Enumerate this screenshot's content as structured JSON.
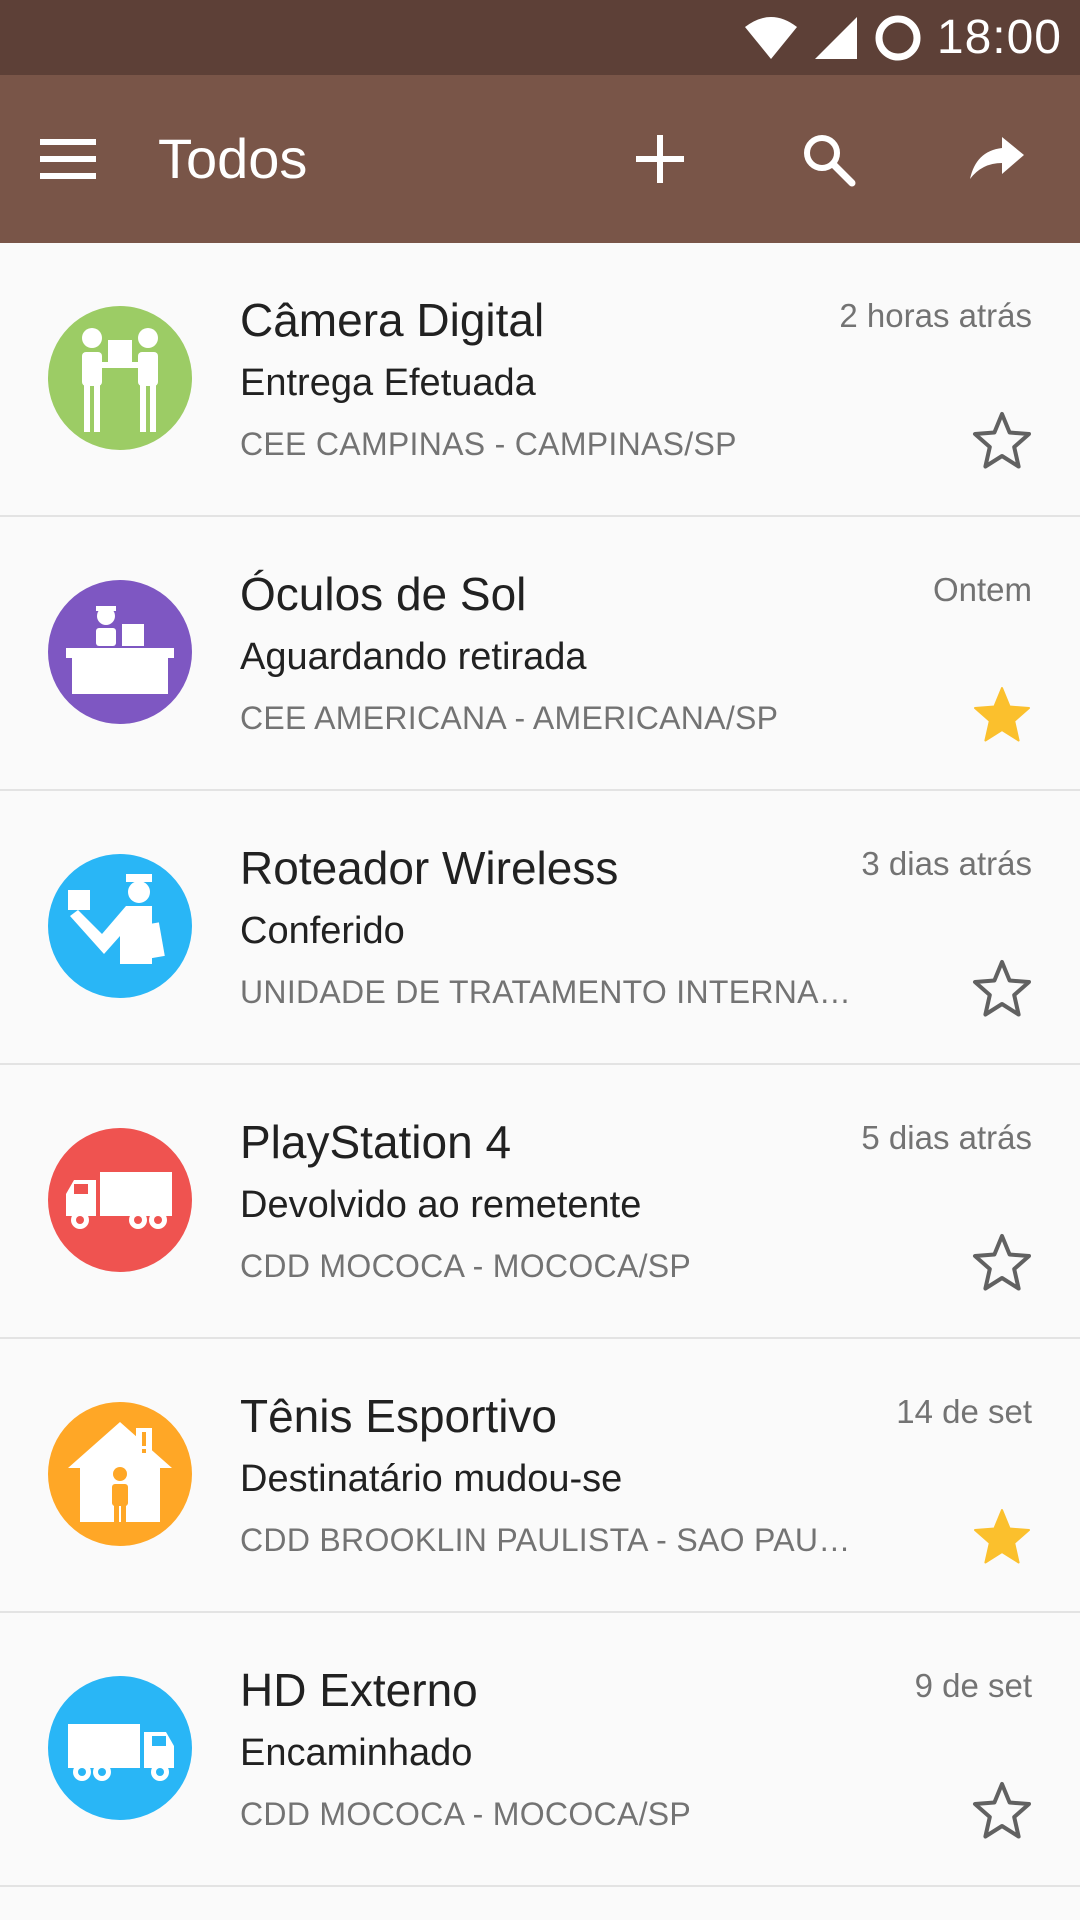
{
  "status_bar": {
    "time": "18:00",
    "icons": [
      "wifi-icon",
      "signal-icon",
      "sync-icon"
    ]
  },
  "app_bar": {
    "title": "Todos",
    "icons": [
      "menu-icon",
      "add-icon",
      "search-icon",
      "share-icon"
    ]
  },
  "colors": {
    "status_bar": "#5d4037",
    "app_bar": "#795548",
    "star_filled": "#fbc02d",
    "star_empty": "#616161"
  },
  "items": [
    {
      "product": "Câmera Digital",
      "status": "Entrega Efetuada",
      "location": "CEE CAMPINAS - CAMPINAS/SP",
      "when": "2 horas atrás",
      "starred": false,
      "icon": "delivered-handover-icon",
      "color": "#9ccc65"
    },
    {
      "product": "Óculos de Sol",
      "status": "Aguardando retirada",
      "location": "CEE AMERICANA - AMERICANA/SP",
      "when": "Ontem",
      "starred": true,
      "icon": "pickup-counter-icon",
      "color": "#7e57c2"
    },
    {
      "product": "Roteador Wireless",
      "status": "Conferido",
      "location": "UNIDADE DE TRATAMENTO INTERNACIONAL",
      "when": "3 dias atrás",
      "starred": false,
      "icon": "inspector-icon",
      "color": "#29b6f6"
    },
    {
      "product": "PlayStation 4",
      "status": "Devolvido ao remetente",
      "location": "CDD MOCOCA - MOCOCA/SP",
      "when": "5 dias atrás",
      "starred": false,
      "icon": "truck-return-icon",
      "color": "#ef5350"
    },
    {
      "product": "Tênis Esportivo",
      "status": "Destinatário mudou-se",
      "location": "CDD BROOKLIN PAULISTA - SAO PAULO/SP",
      "when": "14 de set",
      "starred": true,
      "icon": "house-moved-icon",
      "color": "#ffa726"
    },
    {
      "product": "HD Externo",
      "status": "Encaminhado",
      "location": "CDD MOCOCA - MOCOCA/SP",
      "when": "9 de set",
      "starred": false,
      "icon": "truck-forward-icon",
      "color": "#29b6f6"
    }
  ]
}
